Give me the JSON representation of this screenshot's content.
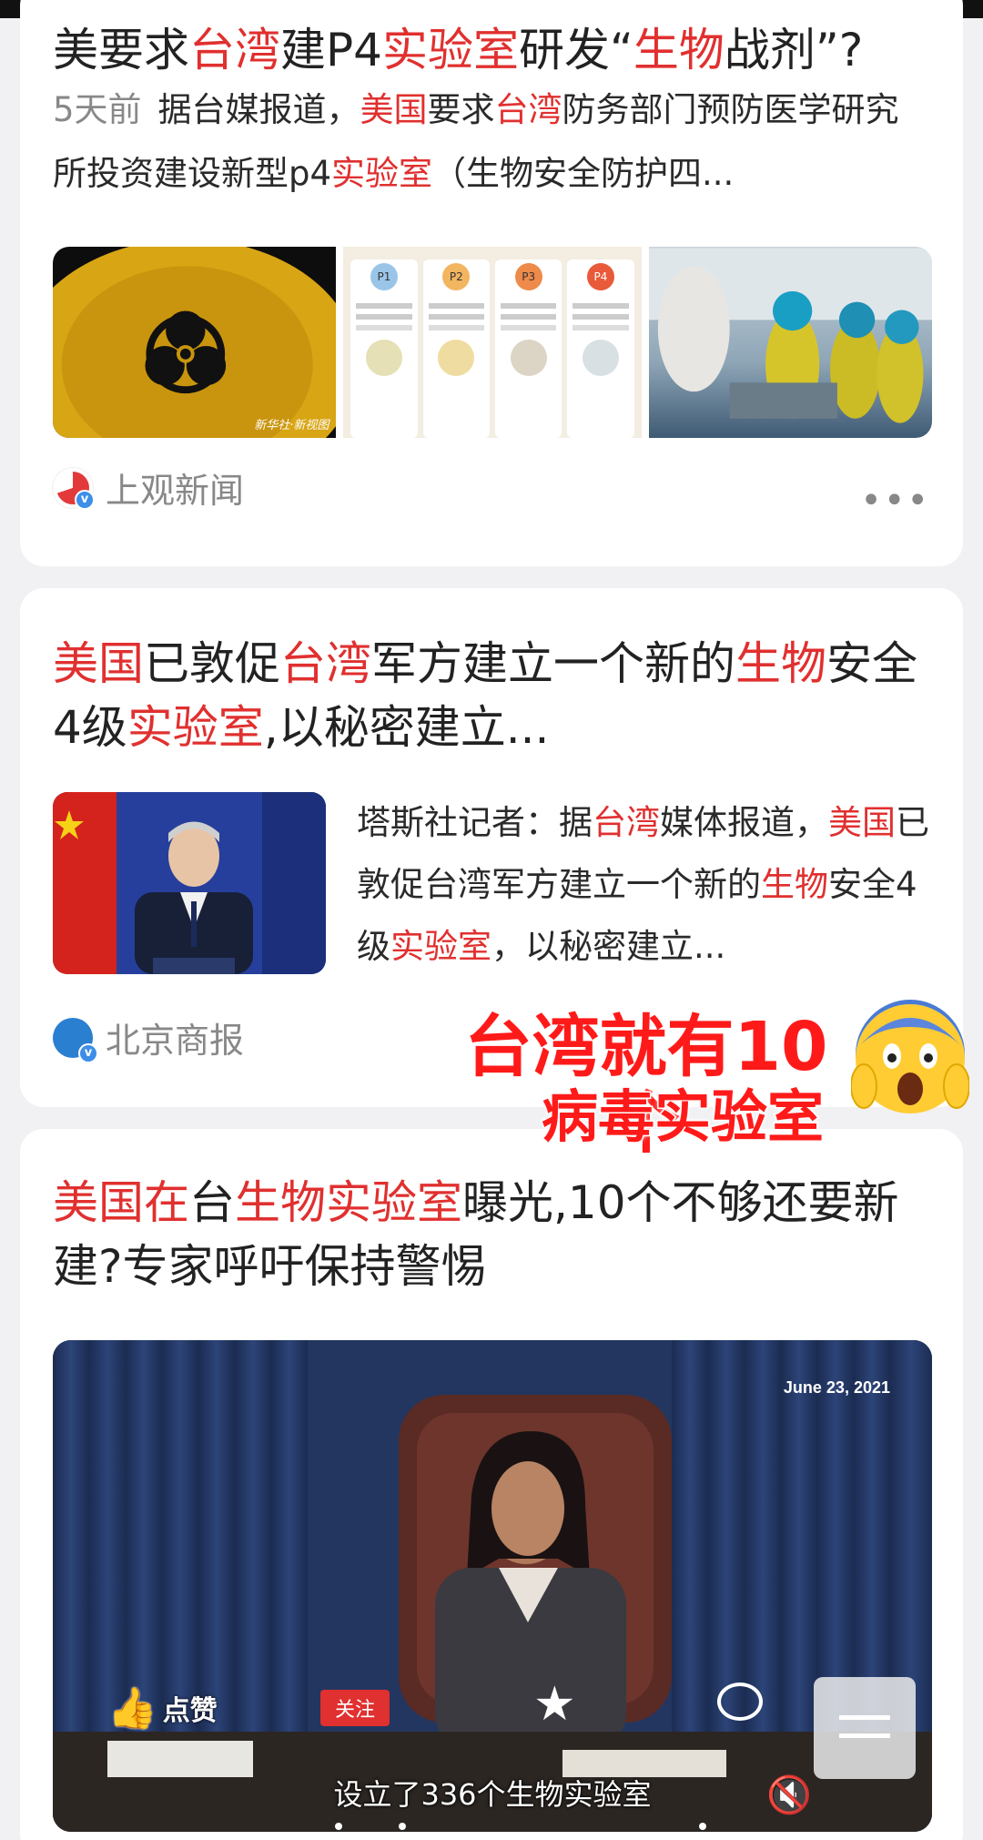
{
  "card1": {
    "title_segments": [
      {
        "text": "美要求",
        "hl": false
      },
      {
        "text": "台湾",
        "hl": true
      },
      {
        "text": "建P4",
        "hl": false
      },
      {
        "text": "实验室",
        "hl": true
      },
      {
        "text": "研发“",
        "hl": false
      },
      {
        "text": "生物",
        "hl": true
      },
      {
        "text": "战剂”?",
        "hl": false
      }
    ],
    "time": "5天前",
    "snippet_segments": [
      {
        "text": "据台媒报道，",
        "hl": false
      },
      {
        "text": "美国",
        "hl": true
      },
      {
        "text": "要求",
        "hl": false
      },
      {
        "text": "台湾",
        "hl": true
      },
      {
        "text": "防务部门预防医学研究所投资建设新型p4",
        "hl": false
      },
      {
        "text": "实验室",
        "hl": true
      },
      {
        "text": "（生物安全防护四...",
        "hl": false
      }
    ],
    "thumb2_labels": [
      "P1",
      "P2",
      "P3",
      "P4"
    ],
    "thumb1_watermark": "新华社·新视图",
    "source": "上观新闻",
    "more": "•••"
  },
  "card2": {
    "title_segments": [
      {
        "text": "美国",
        "hl": true
      },
      {
        "text": "已敦促",
        "hl": false
      },
      {
        "text": "台湾",
        "hl": true
      },
      {
        "text": "军方建立一个新的",
        "hl": false
      },
      {
        "text": "生物",
        "hl": true
      },
      {
        "text": "安全4级",
        "hl": false
      },
      {
        "text": "实验室",
        "hl": true
      },
      {
        "text": ",以秘密建立...",
        "hl": false
      }
    ],
    "snippet_segments": [
      {
        "text": "塔斯社记者：据",
        "hl": false
      },
      {
        "text": "台湾",
        "hl": true
      },
      {
        "text": "媒体报道，",
        "hl": false
      },
      {
        "text": "美国",
        "hl": true
      },
      {
        "text": "已敦促台湾军方建立一个新的",
        "hl": false
      },
      {
        "text": "生物",
        "hl": true
      },
      {
        "text": "安全4级",
        "hl": false
      },
      {
        "text": "实验室",
        "hl": true
      },
      {
        "text": "，以秘密建立...",
        "hl": false
      }
    ],
    "source": "北京商报"
  },
  "overlay": {
    "line1": "台湾就有10个",
    "line2": "病毒实验室"
  },
  "card3": {
    "title_segments": [
      {
        "text": "美国在",
        "hl": true
      },
      {
        "text": "台",
        "hl": false
      },
      {
        "text": "生物实验室",
        "hl": true
      },
      {
        "text": "曝光,10个不够还要新建?专家呼吁保持警惕",
        "hl": false
      }
    ],
    "video": {
      "date": "June 23, 2021",
      "like_label": "点赞",
      "follow_label": "关注",
      "subtitle": "设立了336个生物实验室"
    }
  },
  "colors": {
    "highlight": "#e0302f",
    "overlay_text": "#ff1a1a",
    "follow_button": "#e0302f"
  }
}
